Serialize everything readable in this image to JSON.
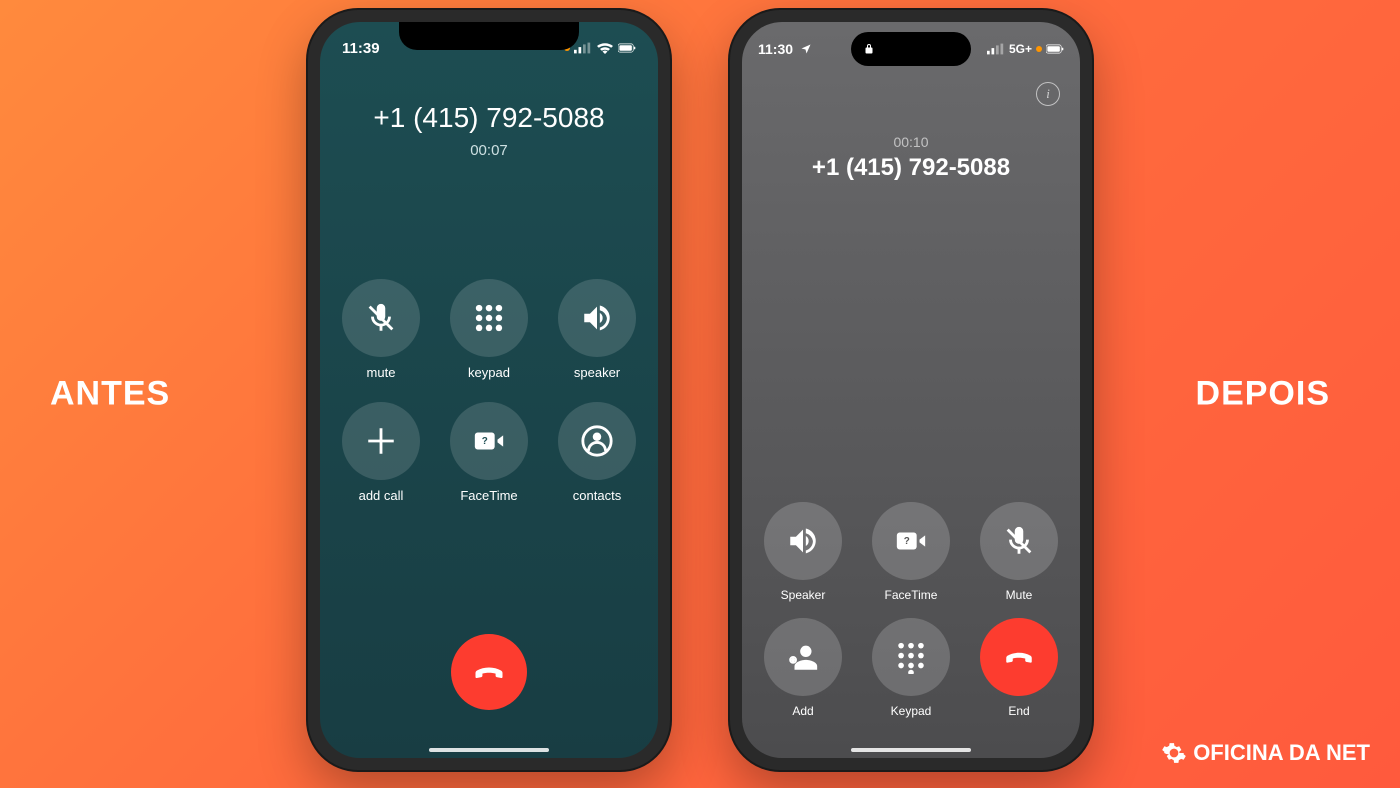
{
  "labels": {
    "before": "ANTES",
    "after": "DEPOIS"
  },
  "watermark": "OFICINA DA NET",
  "left_phone": {
    "status": {
      "time": "11:39"
    },
    "caller": {
      "number": "+1 (415) 792-5088",
      "duration": "00:07"
    },
    "buttons": {
      "mute": "mute",
      "keypad": "keypad",
      "speaker": "speaker",
      "add_call": "add call",
      "facetime": "FaceTime",
      "contacts": "contacts"
    }
  },
  "right_phone": {
    "status": {
      "time": "11:30",
      "network": "5G+"
    },
    "caller": {
      "duration": "00:10",
      "number": "+1 (415) 792-5088"
    },
    "buttons": {
      "speaker": "Speaker",
      "facetime": "FaceTime",
      "mute": "Mute",
      "add": "Add",
      "keypad": "Keypad",
      "end": "End"
    }
  }
}
